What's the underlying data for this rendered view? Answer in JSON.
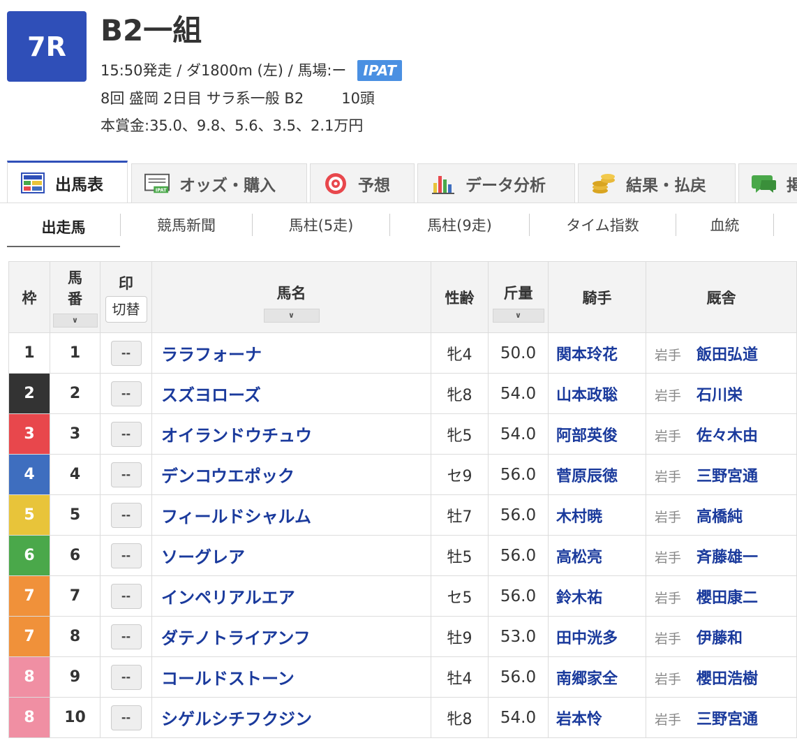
{
  "race": {
    "number": "7R",
    "title": "B2一組",
    "info_line": "15:50発走 / ダ1800m (左) / 馬場:ー",
    "ipat_label": "IPAT",
    "meeting": "8回 盛岡 2日目 サラ系一般 B2",
    "heads": "10頭",
    "prize": "本賞金:35.0、9.8、5.6、3.5、2.1万円"
  },
  "main_tabs": [
    {
      "label": "出馬表",
      "icon": "race-card-icon"
    },
    {
      "label": "オッズ・購入",
      "icon": "ipat-odds-icon"
    },
    {
      "label": "予想",
      "icon": "target-icon"
    },
    {
      "label": "データ分析",
      "icon": "bar-chart-icon"
    },
    {
      "label": "結果・払戻",
      "icon": "coins-icon"
    },
    {
      "label": "掲",
      "icon": "chat-bubble-icon"
    }
  ],
  "sub_tabs": [
    "出走馬",
    "競馬新聞",
    "馬柱(5走)",
    "馬柱(9走)",
    "タイム指数",
    "血統"
  ],
  "table": {
    "headers": {
      "waku": "枠",
      "umaban": "馬番",
      "mark": "印",
      "mark_switch": "切替",
      "name": "馬名",
      "sex_age": "性齢",
      "weight": "斤量",
      "jockey": "騎手",
      "trainer": "厩舎",
      "sort_glyph": "∨"
    },
    "mark_placeholder": "--",
    "rows": [
      {
        "waku": "1",
        "umaban": "1",
        "name": "ララフォーナ",
        "sex_age": "牝4",
        "weight": "50.0",
        "jockey": "関本玲花",
        "region": "岩手",
        "trainer": "飯田弘道"
      },
      {
        "waku": "2",
        "umaban": "2",
        "name": "スズヨローズ",
        "sex_age": "牝8",
        "weight": "54.0",
        "jockey": "山本政聡",
        "region": "岩手",
        "trainer": "石川栄"
      },
      {
        "waku": "3",
        "umaban": "3",
        "name": "オイランドウチュウ",
        "sex_age": "牝5",
        "weight": "54.0",
        "jockey": "阿部英俊",
        "region": "岩手",
        "trainer": "佐々木由"
      },
      {
        "waku": "4",
        "umaban": "4",
        "name": "デンコウエポック",
        "sex_age": "セ9",
        "weight": "56.0",
        "jockey": "菅原辰徳",
        "region": "岩手",
        "trainer": "三野宮通"
      },
      {
        "waku": "5",
        "umaban": "5",
        "name": "フィールドシャルム",
        "sex_age": "牡7",
        "weight": "56.0",
        "jockey": "木村暁",
        "region": "岩手",
        "trainer": "高橋純"
      },
      {
        "waku": "6",
        "umaban": "6",
        "name": "ソーグレア",
        "sex_age": "牡5",
        "weight": "56.0",
        "jockey": "高松亮",
        "region": "岩手",
        "trainer": "斉藤雄一"
      },
      {
        "waku": "7",
        "umaban": "7",
        "name": "インペリアルエア",
        "sex_age": "セ5",
        "weight": "56.0",
        "jockey": "鈴木祐",
        "region": "岩手",
        "trainer": "櫻田康二"
      },
      {
        "waku": "7",
        "umaban": "8",
        "name": "ダテノトライアンフ",
        "sex_age": "牡9",
        "weight": "53.0",
        "jockey": "田中洸多",
        "region": "岩手",
        "trainer": "伊藤和"
      },
      {
        "waku": "8",
        "umaban": "9",
        "name": "コールドストーン",
        "sex_age": "牡4",
        "weight": "56.0",
        "jockey": "南郷家全",
        "region": "岩手",
        "trainer": "櫻田浩樹"
      },
      {
        "waku": "8",
        "umaban": "10",
        "name": "シゲルシチフクジン",
        "sex_age": "牝8",
        "weight": "54.0",
        "jockey": "岩本怜",
        "region": "岩手",
        "trainer": "三野宮通"
      }
    ]
  },
  "colors": {
    "accent": "#2f4fb8",
    "link": "#1a3a9c",
    "ipat": "#4a90e2",
    "waku": {
      "1": {
        "bg": "#ffffff",
        "fg": "#333333"
      },
      "2": {
        "bg": "#333333",
        "fg": "#ffffff"
      },
      "3": {
        "bg": "#e8474c",
        "fg": "#ffffff"
      },
      "4": {
        "bg": "#3e6ebf",
        "fg": "#ffffff"
      },
      "5": {
        "bg": "#e8c43a",
        "fg": "#ffffff"
      },
      "6": {
        "bg": "#4aa84a",
        "fg": "#ffffff"
      },
      "7": {
        "bg": "#f0913a",
        "fg": "#ffffff"
      },
      "8": {
        "bg": "#f08fa3",
        "fg": "#ffffff"
      }
    }
  }
}
